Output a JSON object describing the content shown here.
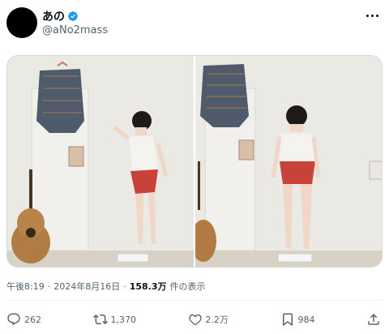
{
  "user": {
    "display_name": "あの",
    "handle": "@aNo2mass",
    "verified_icon": "verified-badge-icon",
    "verified_color": "#1d9bf0"
  },
  "media": {
    "photos": [
      {
        "label": "mirror-photo-1"
      },
      {
        "label": "mirror-photo-2"
      }
    ]
  },
  "meta": {
    "time": "午後8:19",
    "sep1": "·",
    "date": "2024年8月16日",
    "sep2": "·",
    "views_count": "158.3万",
    "views_label": "件の表示"
  },
  "actions": {
    "reply_count": "262",
    "retweet_count": "1,370",
    "like_count": "2.2万",
    "bookmark_count": "984"
  },
  "colors": {
    "text": "#0f1419",
    "secondary": "#536471",
    "accent": "#1d9bf0"
  }
}
